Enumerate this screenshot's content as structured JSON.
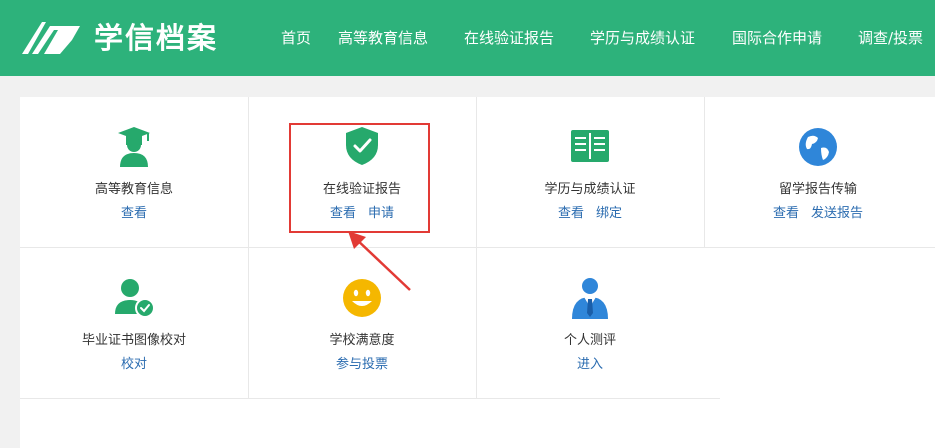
{
  "header": {
    "brand": "学信档案",
    "nav": [
      "首页",
      "高等教育信息",
      "在线验证报告",
      "学历与成绩认证",
      "国际合作申请",
      "调查/投票"
    ]
  },
  "colors": {
    "header_bg": "#2db27b",
    "icon_green": "#26a96c",
    "icon_blue": "#2f86d9",
    "icon_yellow": "#f5b700",
    "link": "#2b6cb0",
    "highlight": "#e23a35"
  },
  "cards": [
    {
      "icon": "graduate-cap-icon",
      "title": "高等教育信息",
      "links": [
        "查看"
      ]
    },
    {
      "icon": "shield-check-icon",
      "title": "在线验证报告",
      "links": [
        "查看",
        "申请"
      ]
    },
    {
      "icon": "open-book-icon",
      "title": "学历与成绩认证",
      "links": [
        "查看",
        "绑定"
      ]
    },
    {
      "icon": "globe-icon",
      "title": "留学报告传输",
      "links": [
        "查看",
        "发送报告"
      ]
    },
    {
      "icon": "user-check-icon",
      "title": "毕业证书图像校对",
      "links": [
        "校对"
      ]
    },
    {
      "icon": "smiley-icon",
      "title": "学校满意度",
      "links": [
        "参与投票"
      ]
    },
    {
      "icon": "person-tie-icon",
      "title": "个人测评",
      "links": [
        "进入"
      ]
    }
  ]
}
